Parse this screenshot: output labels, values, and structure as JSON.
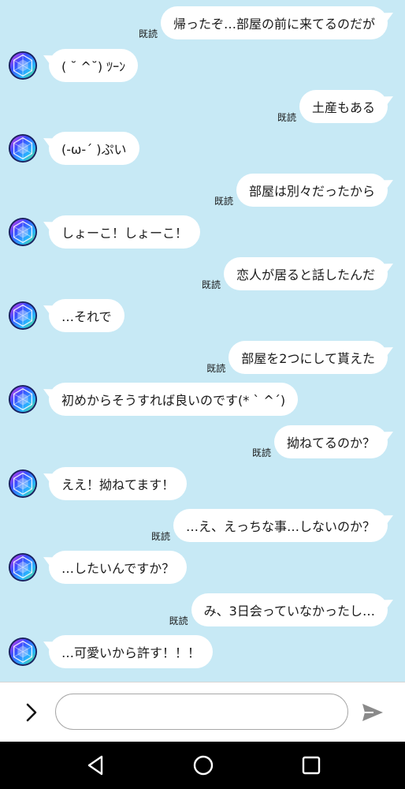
{
  "messages": [
    {
      "side": "me",
      "text": "帰ったぞ…部屋の前に来てるのだが",
      "read": "既読"
    },
    {
      "side": "them",
      "text": "( ˘ ^˘) ﾂｰﾝ"
    },
    {
      "side": "me",
      "text": "土産もある",
      "read": "既読"
    },
    {
      "side": "them",
      "text": "(-ω-´ )ぷい"
    },
    {
      "side": "me",
      "text": "部屋は別々だったから",
      "read": "既読"
    },
    {
      "side": "them",
      "text": "しょーこ！しょーこ！"
    },
    {
      "side": "me",
      "text": "恋人が居ると話したんだ",
      "read": "既読"
    },
    {
      "side": "them",
      "text": "…それで"
    },
    {
      "side": "me",
      "text": "部屋を2つにして貰えた",
      "read": "既読"
    },
    {
      "side": "them",
      "text": "初めからそうすれば良いのです(* ˋ ^´)"
    },
    {
      "side": "me",
      "text": "拗ねてるのか？",
      "read": "既読"
    },
    {
      "side": "them",
      "text": "ええ！拗ねてます！"
    },
    {
      "side": "me",
      "text": "…え、えっちな事…しないのか？",
      "read": "既読"
    },
    {
      "side": "them",
      "text": "…したいんですか？"
    },
    {
      "side": "me",
      "text": "み、3日会っていなかったし…",
      "read": "既読"
    },
    {
      "side": "them",
      "text": "…可愛いから許す！！！"
    }
  ],
  "composer": {
    "input_value": "",
    "expand_icon": "chevron-right-icon",
    "send_icon": "send-icon"
  },
  "navbar": {
    "icons": [
      "back-icon",
      "home-icon",
      "recents-icon"
    ]
  },
  "colors": {
    "chat_background": "#c7e9f5",
    "bubble": "#ffffff",
    "composer": "#ffffff",
    "navbar": "#000000"
  }
}
